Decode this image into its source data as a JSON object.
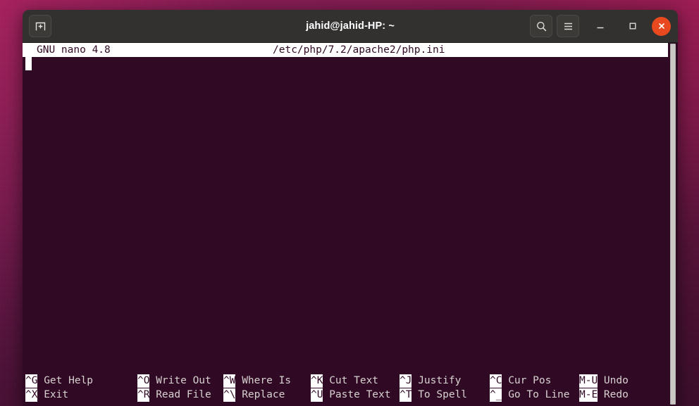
{
  "window": {
    "title": "jahid@jahid-HP: ~",
    "titlebar_color": "#323130",
    "close_button_color": "#e8491f",
    "terminal_bg": "#300a24",
    "terminal_fg": "#d8d2d0"
  },
  "titlebar": {
    "new_tab_icon": "new-tab-icon",
    "search_icon": "search-icon",
    "menu_icon": "hamburger-menu-icon",
    "minimize_icon": "minimize-icon",
    "maximize_icon": "maximize-icon",
    "close_icon": "close-icon"
  },
  "nano": {
    "version": "GNU nano 4.8",
    "filename": "/etc/php/7.2/apache2/php.ini",
    "buffer_lines": [
      ""
    ],
    "cursor": {
      "line": 1,
      "column": 1
    },
    "shortcuts_row1": [
      {
        "key": "^G",
        "label": "Get Help"
      },
      {
        "key": "^O",
        "label": "Write Out"
      },
      {
        "key": "^W",
        "label": "Where Is"
      },
      {
        "key": "^K",
        "label": "Cut Text"
      },
      {
        "key": "^J",
        "label": "Justify"
      },
      {
        "key": "^C",
        "label": "Cur Pos"
      },
      {
        "key": "M-U",
        "label": "Undo"
      }
    ],
    "shortcuts_row2": [
      {
        "key": "^X",
        "label": "Exit"
      },
      {
        "key": "^R",
        "label": "Read File"
      },
      {
        "key": "^\\",
        "label": "Replace"
      },
      {
        "key": "^U",
        "label": "Paste Text"
      },
      {
        "key": "^T",
        "label": "To Spell"
      },
      {
        "key": "^_",
        "label": "Go To Line"
      },
      {
        "key": "M-E",
        "label": "Redo"
      }
    ]
  },
  "scrollbar": {
    "position": "right",
    "thumb_color": "#c9c6c3"
  }
}
